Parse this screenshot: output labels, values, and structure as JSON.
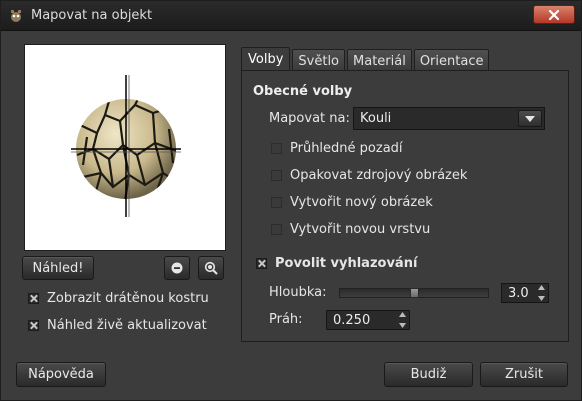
{
  "window": {
    "title": "Mapovat na objekt"
  },
  "preview": {
    "button_label": "Náhled!",
    "zoom_out_icon": "zoom-out-icon",
    "zoom_fit_icon": "zoom-fit-icon"
  },
  "options": {
    "wireframe_label": "Zobrazit drátěnou kostru",
    "wireframe_checked": true,
    "live_preview_label": "Náhled živě aktualizovat",
    "live_preview_checked": true
  },
  "tabs": [
    {
      "label": "Volby",
      "active": true
    },
    {
      "label": "Světlo",
      "active": false
    },
    {
      "label": "Materiál",
      "active": false
    },
    {
      "label": "Orientace",
      "active": false
    }
  ],
  "general": {
    "section_title": "Obecné volby",
    "map_to_label": "Mapovat na:",
    "map_to_value": "Kouli",
    "checkboxes": [
      {
        "label": "Průhledné pozadí",
        "checked": false
      },
      {
        "label": "Opakovat zdrojový obrázek",
        "checked": false
      },
      {
        "label": "Vytvořit nový obrázek",
        "checked": false
      },
      {
        "label": "Vytvořit novou vrstvu",
        "checked": false
      }
    ]
  },
  "antialias": {
    "label": "Povolit vyhlazování",
    "checked": true,
    "depth_label": "Hloubka:",
    "depth_value": "3.0",
    "depth_fraction": 0.5,
    "threshold_label": "Práh:",
    "threshold_value": "0.250"
  },
  "buttons": {
    "help": "Nápověda",
    "ok": "Budiž",
    "cancel": "Zrušit"
  },
  "colors": {
    "background": "#3c3c3c",
    "close_button": "#b4382a",
    "preview_background": "#ffffff",
    "sphere_texture": "#d9cfa8"
  }
}
